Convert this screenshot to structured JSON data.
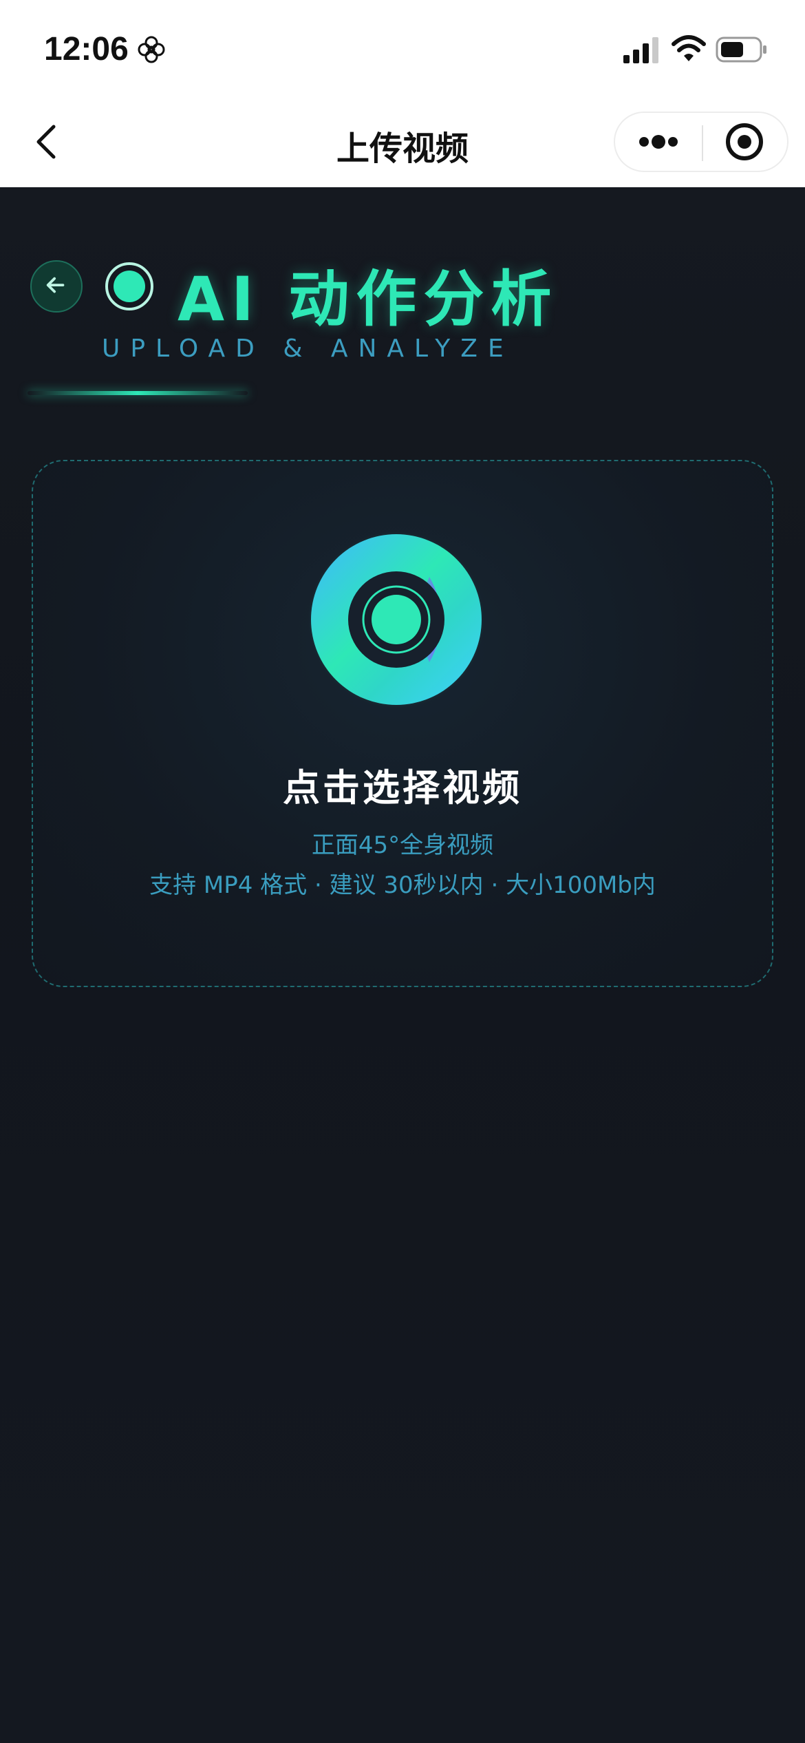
{
  "status_bar": {
    "time": "12:06",
    "icons": [
      "flower-icon",
      "signal-icon",
      "wifi-icon",
      "battery-icon"
    ]
  },
  "nav_bar": {
    "title": "上传视频",
    "back_icon": "chevron-left-icon",
    "more_icon": "more-dots-icon",
    "close_icon": "target-circle-icon"
  },
  "header": {
    "title": "AI 动作分析",
    "subtitle": "UPLOAD & ANALYZE",
    "back_icon": "arrow-left-icon",
    "logo_icon": "record-circle-icon"
  },
  "upload": {
    "title": "点击选择视频",
    "hint": "正面45°全身视频",
    "description": "支持 MP4 格式 · 建议 30秒以内 · 大小100Mb内",
    "icon": "record-lens-icon"
  },
  "colors": {
    "accent": "#2ee8b6",
    "secondary_text": "#3a9dbf",
    "background": "#12161d",
    "purple_accent": "#8a4dff"
  }
}
